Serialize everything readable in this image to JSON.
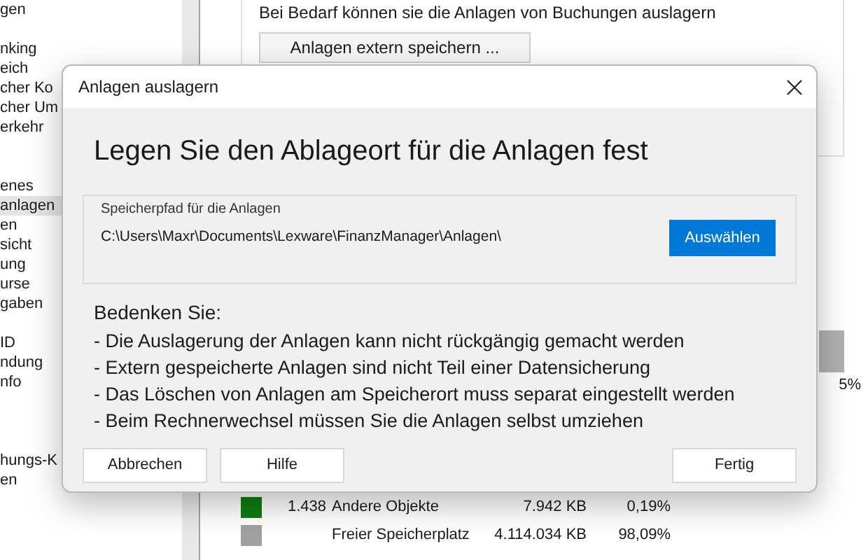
{
  "sidebar": {
    "items": [
      {
        "kind": "entry",
        "label": "gen",
        "selected": false
      },
      {
        "kind": "spacer"
      },
      {
        "kind": "entry",
        "label": "nking",
        "selected": false
      },
      {
        "kind": "entry",
        "label": "eich",
        "selected": false
      },
      {
        "kind": "entry",
        "label": "cher Ko",
        "selected": false
      },
      {
        "kind": "entry",
        "label": "cher Um",
        "selected": false
      },
      {
        "kind": "entry",
        "label": "erkehr",
        "selected": false
      },
      {
        "kind": "spacer"
      },
      {
        "kind": "spacer"
      },
      {
        "kind": "entry",
        "label": "enes",
        "selected": false
      },
      {
        "kind": "entry",
        "label": "anlagen",
        "selected": true
      },
      {
        "kind": "entry",
        "label": "en",
        "selected": false
      },
      {
        "kind": "entry",
        "label": "sicht",
        "selected": false
      },
      {
        "kind": "entry",
        "label": "ung",
        "selected": false
      },
      {
        "kind": "entry",
        "label": "urse",
        "selected": false
      },
      {
        "kind": "entry",
        "label": "gaben",
        "selected": false
      },
      {
        "kind": "spacer"
      },
      {
        "kind": "entry",
        "label": "ID",
        "selected": false
      },
      {
        "kind": "entry",
        "label": "ndung",
        "selected": false
      },
      {
        "kind": "entry",
        "label": "nfo",
        "selected": false
      },
      {
        "kind": "spacer"
      },
      {
        "kind": "spacer"
      },
      {
        "kind": "spacer"
      },
      {
        "kind": "entry",
        "label": "hungs-K",
        "selected": false
      },
      {
        "kind": "entry",
        "label": "en",
        "selected": false
      }
    ]
  },
  "main": {
    "description": "Bei Bedarf können sie die Anlagen von Buchungen auslagern",
    "export_button": "Anlagen extern speichern ...",
    "usage_reading": "5%",
    "legend": [
      {
        "count": "1.438",
        "label": "Andere Objekte",
        "size": "7.942 KB",
        "share": "0,19%",
        "color": "#107c10"
      },
      {
        "label": "Freier Speicherplatz",
        "size": "4.114.034 KB",
        "share": "98,09%",
        "color": "#a0a0a0"
      }
    ]
  },
  "dialog": {
    "title": "Anlagen auslagern",
    "heading": "Legen Sie den Ablageort für die Anlagen fest",
    "group": {
      "label": "Speicherpfad für die Anlagen",
      "path": "C:\\Users\\Maxr\\Documents\\Lexware\\FinanzManager\\Anlagen\\",
      "button": "Auswählen"
    },
    "notes_title": "Bedenken Sie:",
    "notes": [
      "- Die Auslagerung der Anlagen kann nicht rückgängig gemacht werden",
      "- Extern gespeicherte Anlagen sind nicht Teil einer Datensicherung",
      "- Das Löschen von Anlagen am Speicherort muss separat eingestellt werden",
      "- Beim Rechnerwechsel müssen Sie die Anlagen selbst umziehen"
    ],
    "buttons": [
      {
        "label": "Abbrechen",
        "kind": "left"
      },
      {
        "label": "Hilfe",
        "kind": "left"
      },
      {
        "label": "Fertig",
        "kind": "right"
      }
    ]
  }
}
